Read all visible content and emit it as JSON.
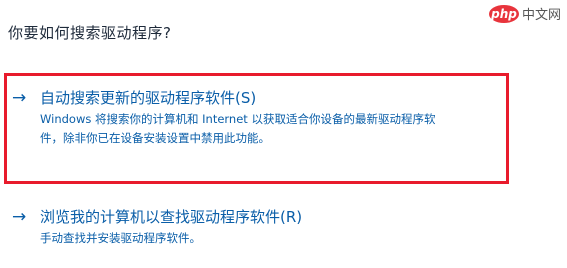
{
  "question": "你要如何搜索驱动程序?",
  "watermark": {
    "logo_text": "php",
    "site_text": "中文网"
  },
  "options": [
    {
      "arrow": "→",
      "title": "自动搜索更新的驱动程序软件(S)",
      "description_line1": "Windows 将搜索你的计算机和 Internet 以获取适合你设备的最新驱动程序软",
      "description_line2": "件，除非你已在设备安装设置中禁用此功能。"
    },
    {
      "arrow": "→",
      "title": "浏览我的计算机以查找驱动程序软件(R)",
      "description_line1": "手动查找并安装驱动程序软件。"
    }
  ],
  "colors": {
    "link_blue": "#0a5ea8",
    "highlight_red": "#e81b2c",
    "heading": "#1e2a3a"
  }
}
